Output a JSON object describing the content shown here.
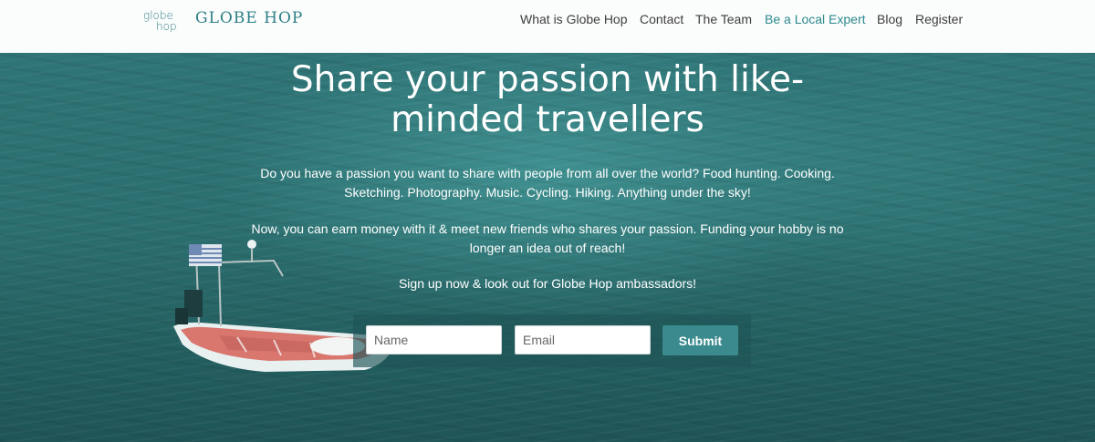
{
  "header": {
    "logo_text": "globe hop",
    "brand": "GLOBE HOP",
    "nav": [
      {
        "label": "What is Globe Hop"
      },
      {
        "label": "Contact"
      },
      {
        "label": "The Team"
      },
      {
        "label": "Be a Local Expert"
      },
      {
        "label": "Blog"
      },
      {
        "label": "Register"
      }
    ]
  },
  "hero": {
    "headline_line1": "Share your passion with like-",
    "headline_line2": "minded travellers",
    "paragraph1_line1": "Do you have a passion you want to share with people from all over the world? Food hunting. Cooking.",
    "paragraph1_line2": "Sketching. Photography. Music. Cycling. Hiking. Anything under the sky!",
    "paragraph2_line1": "Now, you can earn money with it & meet new friends who shares your passion. Funding your hobby is no",
    "paragraph2_line2": "longer an idea out of reach!",
    "paragraph3": "Sign up now & look out for Globe Hop ambassadors!"
  },
  "signup_form": {
    "name_placeholder": "Name",
    "email_placeholder": "Email",
    "submit_label": "Submit"
  },
  "colors": {
    "brand_teal": "#2d7f86",
    "nav_accent": "#2c8a8e",
    "button": "#3b8a8e",
    "hero_bg": "#2c6f70"
  }
}
